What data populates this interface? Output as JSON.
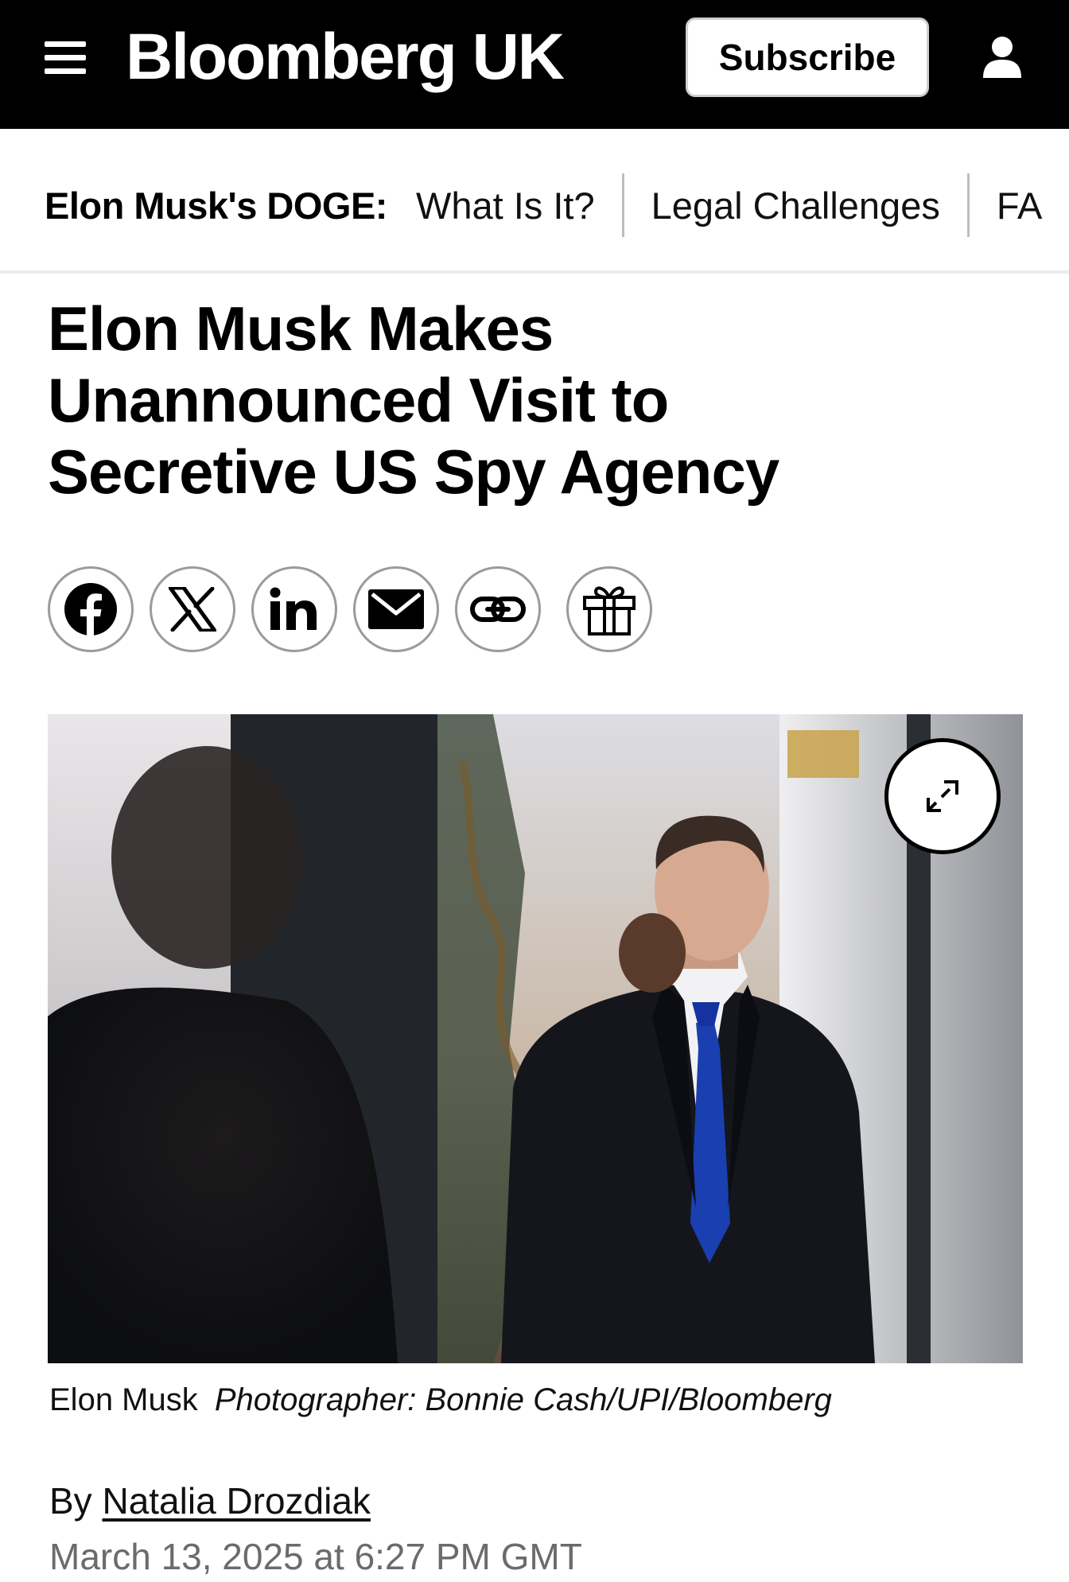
{
  "header": {
    "logo": "Bloomberg UK",
    "subscribe_label": "Subscribe",
    "menu_icon": "hamburger-menu-icon",
    "account_icon": "user-account-icon",
    "background": "#000000"
  },
  "subnav": {
    "label": "Elon Musk's DOGE:",
    "links": [
      "What Is It?",
      "Legal Challenges",
      "FA"
    ]
  },
  "article": {
    "headline_lines": [
      "Elon Musk Makes",
      "Unannounced Visit to",
      "Secretive US Spy Agency"
    ],
    "share_buttons": [
      "facebook-icon",
      "x-icon",
      "linkedin-icon",
      "email-icon",
      "link-icon",
      "gift-icon"
    ],
    "image_expand_icon": "expand-icon",
    "caption": {
      "subject": "Elon Musk",
      "credit": "Photographer: Bonnie Cash/UPI/Bloomberg"
    },
    "byline": {
      "prefix": "By",
      "author": "Natalia Drozdiak"
    },
    "date": "March 13, 2025 at 6:27 PM GMT"
  },
  "colors": {
    "header_bg": "#000000",
    "text": "#000000",
    "date_text": "#6b6b6b",
    "tie": "#1a3fb0"
  }
}
